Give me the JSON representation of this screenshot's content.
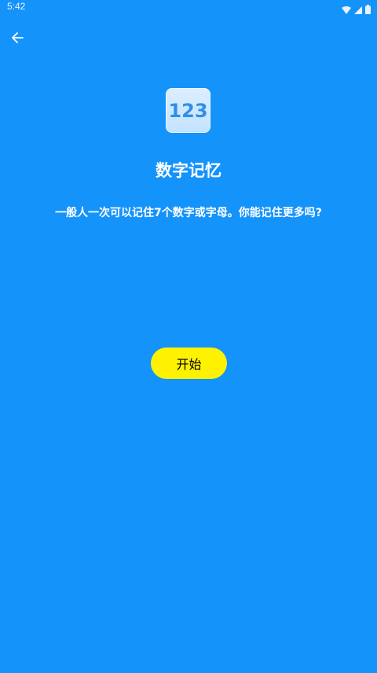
{
  "status_bar": {
    "time": "5:42",
    "icons": [
      "wifi-icon",
      "signal-icon",
      "battery-icon"
    ]
  },
  "toolbar": {
    "back_icon": "arrow-left-icon"
  },
  "game": {
    "icon_text": "123",
    "title": "数字记忆",
    "description": "一般人一次可以记住7个数字或字母。你能记住更多吗?",
    "start_label": "开始"
  },
  "colors": {
    "background": "#1493fb",
    "button": "#fff200",
    "icon_bg": "#cfe8ff",
    "icon_text": "#2f8fe8"
  }
}
